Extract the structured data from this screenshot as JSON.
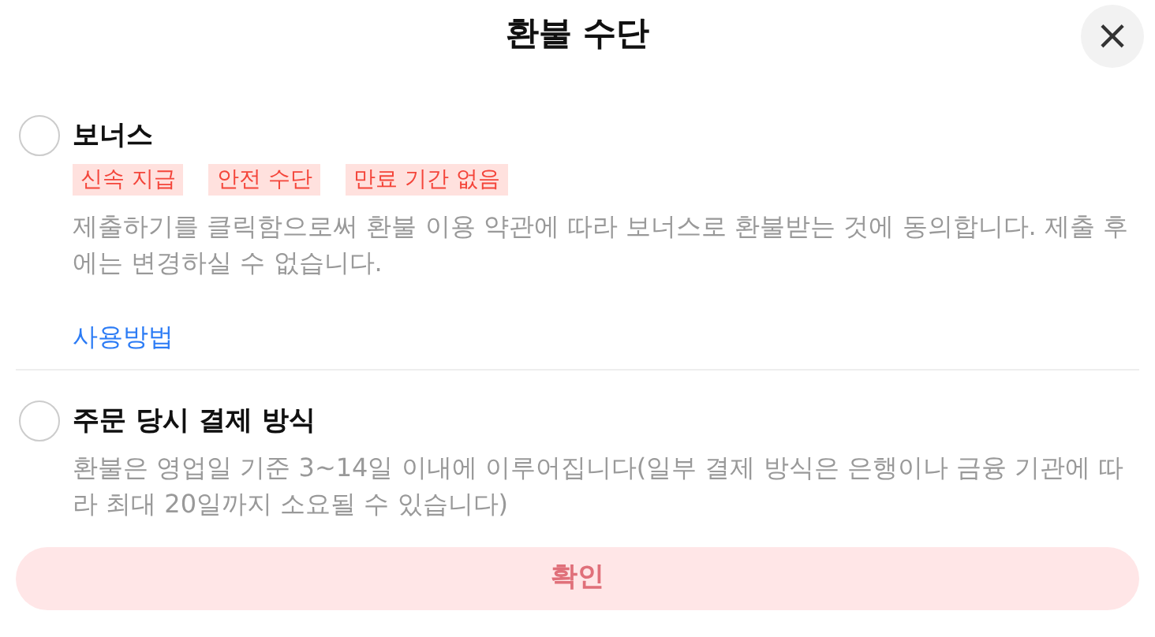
{
  "title": "환불 수단",
  "close": {
    "symbol": "×"
  },
  "options": [
    {
      "label": "보너스",
      "selected": false,
      "tags": [
        "신속 지급",
        "안전 수단",
        "만료 기간 없음"
      ],
      "description": "제출하기를 클릭함으로써 환불 이용 약관에 따라 보너스로 환불받는 것에 동의합니다. 제출 후에는 변경하실 수 없습니다.",
      "link": "사용방법"
    },
    {
      "label": "주문 당시 결제 방식",
      "selected": false,
      "description": "환불은 영업일 기준 3~14일 이내에 이루어집니다(일부 결제 방식은 은행이나 금융 기관에 따라 최대 20일까지 소요될 수 있습니다)"
    }
  ],
  "confirm": {
    "label": "확인",
    "disabled": true
  }
}
